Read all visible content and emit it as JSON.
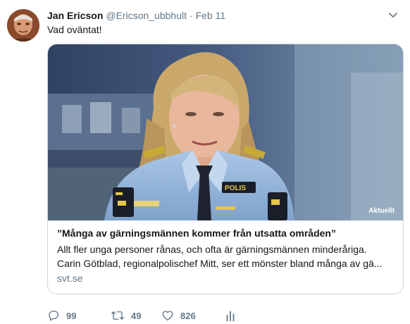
{
  "tweet": {
    "author_name": "Jan Ericson",
    "author_handle": "@Ericson_ubbhult",
    "separator": "·",
    "date": "Feb 11",
    "text": "Vad oväntat!",
    "avatar_icon": "user-avatar"
  },
  "card": {
    "media_tag": "Aktuellt",
    "media_badge_text": "POLIS",
    "title": "”Många av gärningsmännen kommer från utsatta områden”",
    "description_line1": "Allt fler unga personer rånas, och ofta är gärningsmännen minderåriga.",
    "description_line2": "Carin Götblad, regionalpolischef Mitt, ser ett mönster bland många av gä...",
    "domain": "svt.se"
  },
  "actions": {
    "reply_count": "99",
    "retweet_count": "49",
    "like_count": "826",
    "icons": [
      "reply-icon",
      "retweet-icon",
      "like-icon",
      "analytics-icon"
    ]
  },
  "colors": {
    "text": "#14171a",
    "muted": "#657786",
    "border": "#ccd6dd"
  }
}
